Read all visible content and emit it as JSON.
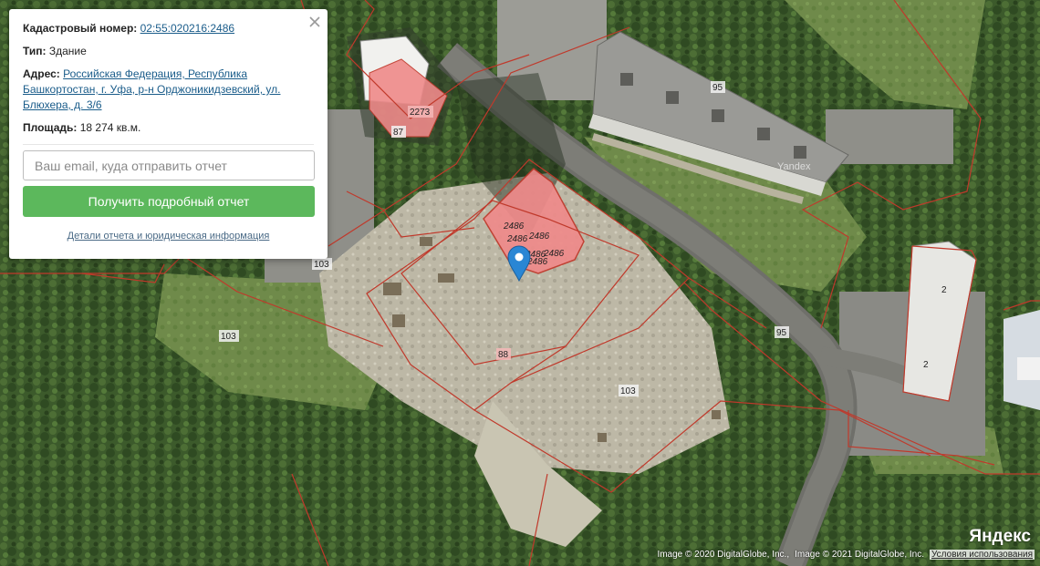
{
  "popup": {
    "cadastral_label": "Кадастровый номер:",
    "cadastral_value": "02:55:020216:2486",
    "type_label": "Тип:",
    "type_value": "Здание",
    "address_label": "Адрес:",
    "address_value": "Российская Федерация, Республика Башкортостан, г. Уфа, р-н Орджоникидзевский, ул. Блюхера, д. 3/6",
    "area_label": "Площадь:",
    "area_value": "18 274 кв.м.",
    "email_placeholder": "Ваш email, куда отправить отчет",
    "submit_label": "Получить подробный отчет",
    "details_link": "Детали отчета и юридическая информация"
  },
  "map": {
    "labels": {
      "p2273": "2273",
      "p87": "87",
      "p95a": "95",
      "p95b": "95",
      "p103a": "103",
      "p103b": "103",
      "p103c": "103",
      "p88": "88",
      "p2a": "2",
      "p2b": "2",
      "b1": "2486",
      "b2": "2486",
      "b3": "2486",
      "b4": "2486",
      "b5": "2486",
      "b6": "2486"
    },
    "watermark": "Yandex"
  },
  "logo": "Яндекс",
  "attribution": {
    "image1": "Image © 2020 DigitalGlobe, Inc.,",
    "image2": "Image © 2021 DigitalGlobe, Inc.",
    "terms": "Условия использования"
  },
  "colors": {
    "parcel_line": "#c0392b",
    "building_fill": "#ef8a8a",
    "button": "#5cb85c",
    "marker": "#2a86d4"
  }
}
